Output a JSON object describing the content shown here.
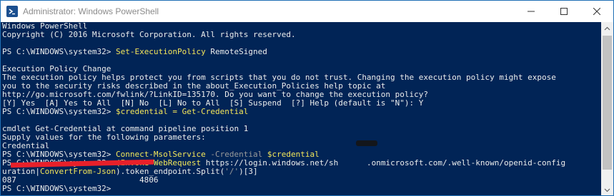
{
  "window": {
    "title": "Administrator: Windows PowerShell",
    "icon": "powershell-icon",
    "controls": [
      "minimize-icon",
      "maximize-icon",
      "close-icon"
    ],
    "background_color": "#012456",
    "text_color": "#ececec",
    "command_color": "#f4e65a",
    "parameter_color": "#9a9a9a"
  },
  "console": {
    "lines": [
      [
        {
          "t": "Windows PowerShell"
        }
      ],
      [
        {
          "t": "Copyright (C) 2016 Microsoft Corporation. All rights reserved."
        }
      ],
      [],
      [
        {
          "t": "PS C:\\WINDOWS\\system32> "
        },
        {
          "t": "Set-ExecutionPolicy",
          "c": "y"
        },
        {
          "t": " RemoteSigned"
        }
      ],
      [],
      [
        {
          "t": "Execution Policy Change"
        }
      ],
      [
        {
          "t": "The execution policy helps protect you from scripts that you do not trust. Changing the execution policy might expose"
        }
      ],
      [
        {
          "t": "you to the security risks described in the about_Execution_Policies help topic at"
        }
      ],
      [
        {
          "t": "http://go.microsoft.com/fwlink/?LinkID=135170. Do you want to change the execution policy?"
        }
      ],
      [
        {
          "t": "[Y] Yes  [A] Yes to All  [N] No  [L] No to All  [S] Suspend  [?] Help (default is \"N\"): Y"
        }
      ],
      [
        {
          "t": "PS C:\\WINDOWS\\system32> "
        },
        {
          "t": "$credential = Get-Credential",
          "c": "y"
        }
      ],
      [],
      [
        {
          "t": "cmdlet Get-Credential at command pipeline position 1"
        }
      ],
      [
        {
          "t": "Supply values for the following parameters:"
        }
      ],
      [
        {
          "t": "Credential"
        }
      ],
      [
        {
          "t": "PS C:\\WINDOWS\\system32> "
        },
        {
          "t": "Connect-MsolService",
          "c": "y"
        },
        {
          "t": " -Credential ",
          "c": "g"
        },
        {
          "t": "$credential",
          "c": "y"
        }
      ],
      [
        {
          "t": "PS C:\\WINDOWS\\system32> "
        },
        {
          "t": "(Invoke-WebRequest",
          "c": "y"
        },
        {
          "t": " https://login.windows.net/sh"
        },
        {
          "t": "      "
        },
        {
          "t": ".onmicrosoft.com/.well-known/openid-config"
        }
      ],
      [
        {
          "t": "uration|"
        },
        {
          "t": "ConvertFrom-Json",
          "c": "y"
        },
        {
          "t": ").token_endpoint.Split("
        },
        {
          "t": "'/'",
          "c": "g"
        },
        {
          "t": ")[3]"
        }
      ],
      [
        {
          "t": "087                          4806"
        }
      ],
      [
        {
          "t": "PS C:\\WINDOWS\\system32> "
        }
      ]
    ]
  },
  "scrollbar": {
    "up_icon": "scroll-up-icon",
    "down_icon": "scroll-down-icon"
  }
}
